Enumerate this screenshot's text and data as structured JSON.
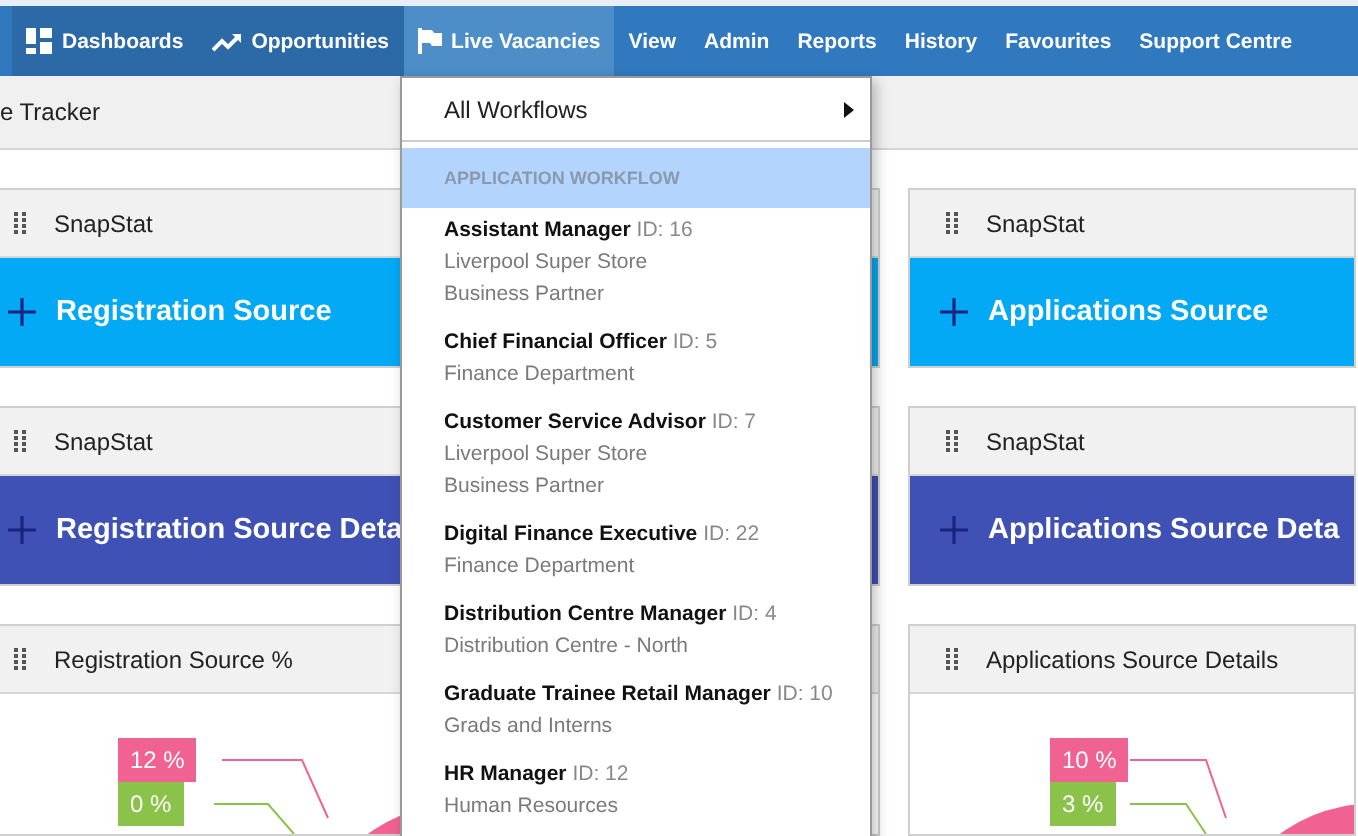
{
  "nav": {
    "items": [
      {
        "label": "Dashboards",
        "selected": false
      },
      {
        "label": "Opportunities",
        "selected": false
      },
      {
        "label": "Live Vacancies",
        "selected": true
      },
      {
        "label": "View",
        "selected": false
      },
      {
        "label": "Admin",
        "selected": false
      },
      {
        "label": "Reports",
        "selected": false
      },
      {
        "label": "History",
        "selected": false
      },
      {
        "label": "Favourites",
        "selected": false
      },
      {
        "label": "Support Centre",
        "selected": false
      }
    ]
  },
  "breadcrumb": "e Tracker",
  "columns": [
    {
      "cards": [
        {
          "kind": "stat",
          "header": "SnapStat",
          "title": "Registration Source",
          "color": "#03a9f4"
        },
        {
          "kind": "stat",
          "header": "SnapStat",
          "title": "Registration Source Deta",
          "color": "#3f51b5"
        },
        {
          "kind": "chart",
          "header": "Registration Source %",
          "labels": [
            {
              "text": "12 %",
              "color": "#f06292"
            },
            {
              "text": "0 %",
              "color": "#8bc34a"
            }
          ]
        }
      ]
    },
    {
      "cards": [
        {
          "kind": "stat",
          "header": "SnapStat",
          "title": "Applications Source",
          "color": "#03a9f4"
        },
        {
          "kind": "stat",
          "header": "SnapStat",
          "title": "Applications Source Deta",
          "color": "#3f51b5"
        },
        {
          "kind": "chart",
          "header": "Applications Source Details",
          "labels": [
            {
              "text": "10 %",
              "color": "#f06292"
            },
            {
              "text": "3 %",
              "color": "#8bc34a"
            }
          ]
        }
      ]
    }
  ],
  "menu": {
    "submenu": "All Workflows",
    "section": "APPLICATION WORKFLOW",
    "items": [
      {
        "title": "Assistant Manager",
        "id": "ID: 16",
        "lines": [
          "Liverpool Super Store",
          "Business Partner"
        ]
      },
      {
        "title": "Chief Financial Officer",
        "id": "ID: 5",
        "lines": [
          "Finance Department"
        ]
      },
      {
        "title": "Customer Service Advisor",
        "id": "ID: 7",
        "lines": [
          "Liverpool Super Store",
          "Business Partner"
        ]
      },
      {
        "title": "Digital Finance Executive",
        "id": "ID: 22",
        "lines": [
          "Finance Department"
        ]
      },
      {
        "title": "Distribution Centre Manager",
        "id": "ID: 4",
        "lines": [
          "Distribution Centre - North"
        ]
      },
      {
        "title": "Graduate Trainee Retail Manager",
        "id": "ID: 10",
        "lines": [
          "Grads and Interns"
        ]
      },
      {
        "title": "HR Manager",
        "id": "ID: 12",
        "lines": [
          "Human Resources"
        ]
      }
    ]
  }
}
